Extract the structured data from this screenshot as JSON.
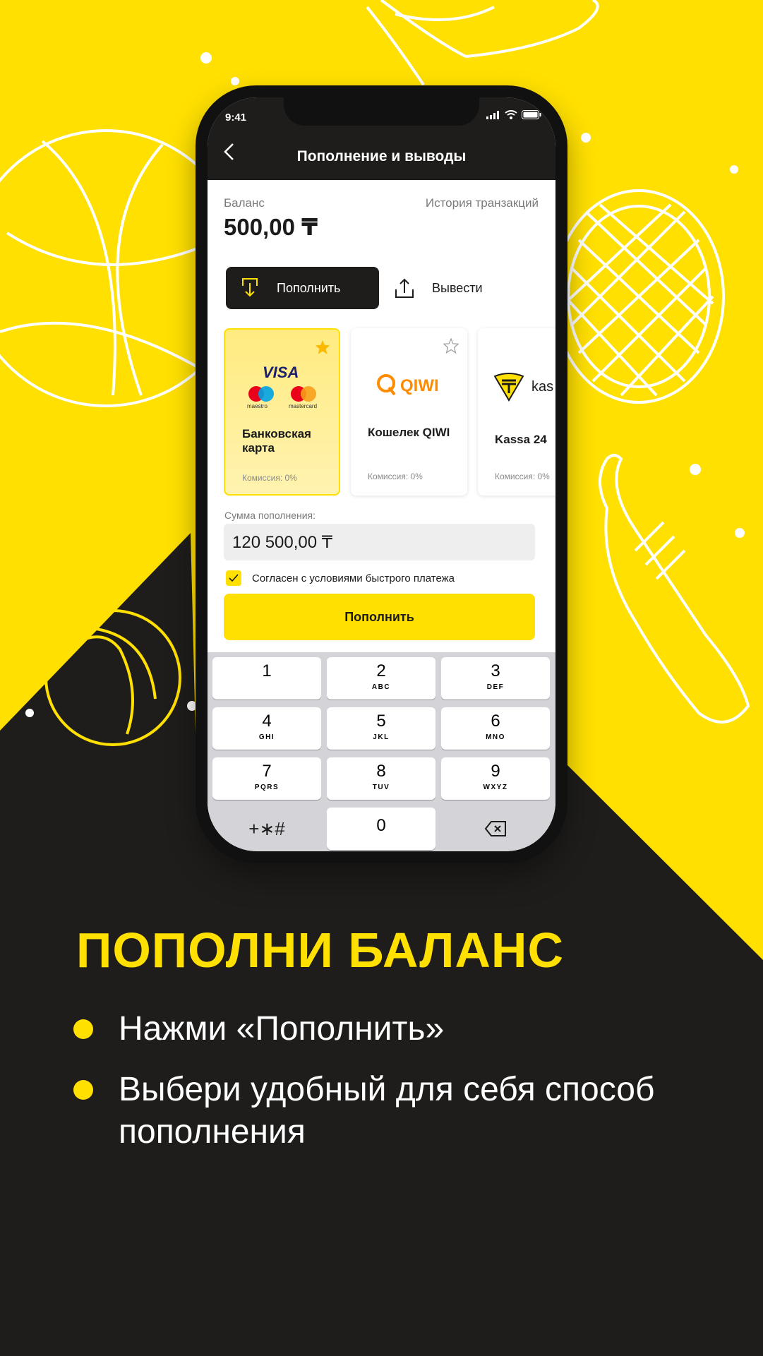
{
  "status": {
    "time": "9:41"
  },
  "header": {
    "title": "Пополнение и выводы"
  },
  "balance": {
    "label": "Баланс",
    "value": "500,00 ₸",
    "history_link": "История транзакций"
  },
  "actions": {
    "deposit": "Пополнить",
    "withdraw": "Вывести"
  },
  "methods": [
    {
      "name": "Банковская карта",
      "fee": "Комиссия: 0%",
      "favorite": true,
      "logo_text": "VISA",
      "logo_sub": [
        "maestro",
        "mastercard"
      ]
    },
    {
      "name": "Кошелек QIWI",
      "fee": "Комиссия: 0%",
      "favorite": false,
      "logo_text": "QIWI"
    },
    {
      "name": "Kassa 24",
      "fee": "Комиссия: 0%",
      "favorite": false,
      "logo_text": "kas"
    }
  ],
  "amount": {
    "label": "Сумма пополнения:",
    "value": "120 500,00 ₸"
  },
  "agreement": {
    "label": "Согласен с условиями быстрого платежа",
    "checked": true
  },
  "submit": {
    "label": "Пополнить"
  },
  "keypad": {
    "keys": [
      {
        "num": "1",
        "sub": ""
      },
      {
        "num": "2",
        "sub": "ABC"
      },
      {
        "num": "3",
        "sub": "DEF"
      },
      {
        "num": "4",
        "sub": "GHI"
      },
      {
        "num": "5",
        "sub": "JKL"
      },
      {
        "num": "6",
        "sub": "MNO"
      },
      {
        "num": "7",
        "sub": "PQRS"
      },
      {
        "num": "8",
        "sub": "TUV"
      },
      {
        "num": "9",
        "sub": "WXYZ"
      }
    ],
    "symbols": "+∗#",
    "zero": "0"
  },
  "promo": {
    "headline": "ПОПОЛНИ БАЛАНС",
    "bullets": [
      "Нажми «Пополнить»",
      "Выбери удобный для себя способ пополнения"
    ]
  },
  "colors": {
    "accent": "#FFE000",
    "dark": "#1E1D1B",
    "qiwi": "#FF8C00",
    "visa": "#1A1F71"
  },
  "icons": [
    "back-arrow-icon",
    "deposit-icon",
    "withdraw-icon",
    "star-icon",
    "check-icon",
    "backspace-icon",
    "signal-icon",
    "wifi-icon",
    "battery-icon"
  ]
}
